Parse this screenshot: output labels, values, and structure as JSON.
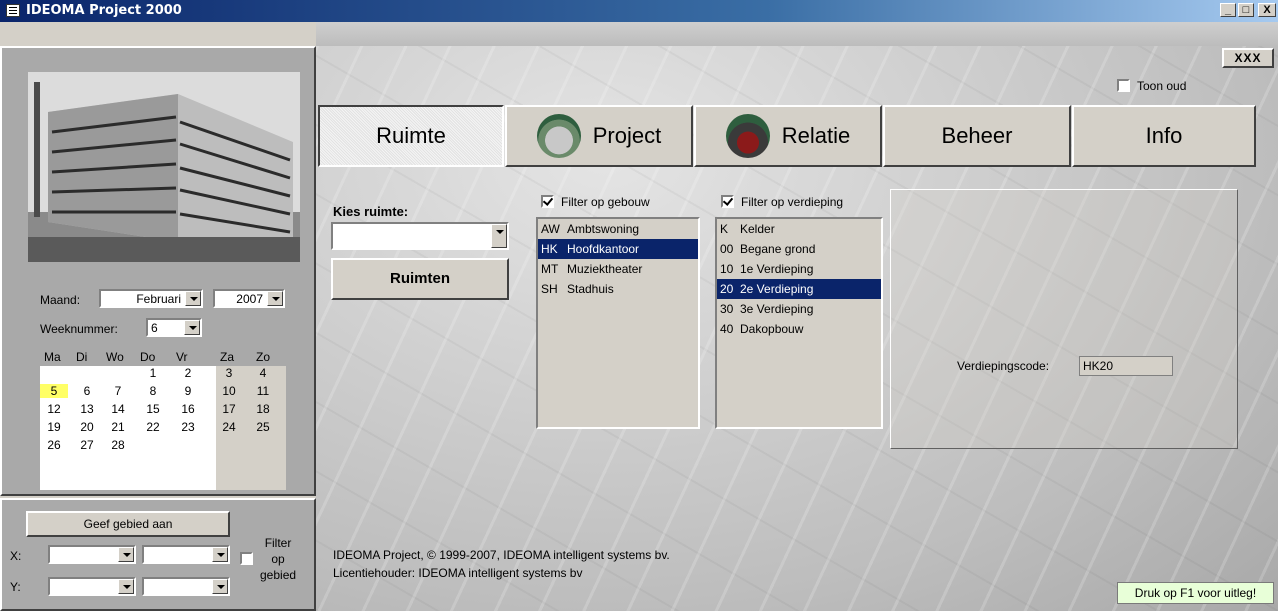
{
  "window": {
    "title": "IDEOMA Project 2000",
    "minimize": "_",
    "maximize": "□",
    "close": "X"
  },
  "toolbar": {
    "xxx_label": "XXX"
  },
  "toon_oud": {
    "label": "Toon oud",
    "checked": false
  },
  "tabs": [
    {
      "label": "Ruimte",
      "active": true,
      "icon": ""
    },
    {
      "label": "Project",
      "active": false,
      "icon": "ideoma-logo-icon"
    },
    {
      "label": "Relatie",
      "active": false,
      "icon": "ideoma-logo-icon"
    },
    {
      "label": "Beheer",
      "active": false,
      "icon": ""
    },
    {
      "label": "Info",
      "active": false,
      "icon": ""
    }
  ],
  "calendar": {
    "maand_label": "Maand:",
    "maand_value": "Februari",
    "jaar_value": "2007",
    "weeknummer_label": "Weeknummer:",
    "weeknummer_value": "6",
    "weekdays": [
      "Ma",
      "Di",
      "Wo",
      "Do",
      "Vr",
      "Za",
      "Zo"
    ],
    "weeks": [
      [
        "",
        "",
        "",
        "1",
        "2",
        "3",
        "4"
      ],
      [
        "5",
        "6",
        "7",
        "8",
        "9",
        "10",
        "11"
      ],
      [
        "12",
        "13",
        "14",
        "15",
        "16",
        "17",
        "18"
      ],
      [
        "19",
        "20",
        "21",
        "22",
        "23",
        "24",
        "25"
      ],
      [
        "26",
        "27",
        "28",
        "",
        "",
        "",
        ""
      ]
    ],
    "today": "5"
  },
  "gebied": {
    "button_label": "Geef gebied aan",
    "x_label": "X:",
    "y_label": "Y:",
    "filter_label_1": "Filter",
    "filter_label_2": "op",
    "filter_label_3": "gebied",
    "filter_checked": false
  },
  "ruimte": {
    "kies_label": "Kies ruimte:",
    "kies_value": "",
    "ruimten_button": "Ruimten"
  },
  "gebouw": {
    "filter_label": "Filter op gebouw",
    "filter_checked": true,
    "items": [
      {
        "code": "AW",
        "name": "Ambtswoning",
        "selected": false
      },
      {
        "code": "HK",
        "name": "Hoofdkantoor",
        "selected": true
      },
      {
        "code": "MT",
        "name": "Muziektheater",
        "selected": false
      },
      {
        "code": "SH",
        "name": "Stadhuis",
        "selected": false
      }
    ]
  },
  "verdieping": {
    "filter_label": "Filter op verdieping",
    "filter_checked": true,
    "items": [
      {
        "code": "K",
        "name": "Kelder",
        "selected": false
      },
      {
        "code": "00",
        "name": "Begane grond",
        "selected": false
      },
      {
        "code": "10",
        "name": "1e Verdieping",
        "selected": false
      },
      {
        "code": "20",
        "name": "2e Verdieping",
        "selected": true
      },
      {
        "code": "30",
        "name": "3e Verdieping",
        "selected": false
      },
      {
        "code": "40",
        "name": "Dakopbouw",
        "selected": false
      }
    ]
  },
  "verdiepingscode": {
    "label": "Verdiepingscode:",
    "value": "HK20"
  },
  "footer": {
    "copyright": "IDEOMA Project, © 1999-2007, IDEOMA intelligent systems bv.",
    "licentie": "Licentiehouder: IDEOMA intelligent systems bv"
  },
  "help": {
    "text": "Druk op F1 voor uitleg!"
  },
  "colors": {
    "selection": "#0a246a",
    "today_highlight": "#ffff66",
    "titlebar": "#0a246a",
    "help_bg": "#e8ffd8"
  }
}
